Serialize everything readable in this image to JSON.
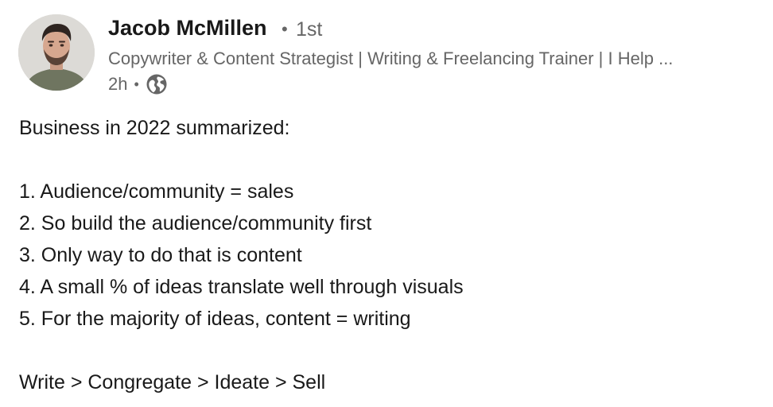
{
  "author": {
    "name": "Jacob McMillen",
    "degree": "1st",
    "headline": "Copywriter & Content Strategist | Writing & Freelancing Trainer | I Help ...",
    "time": "2h",
    "visibility_icon": "globe-icon",
    "separator": "•"
  },
  "post": {
    "line1": "Business in 2022 summarized:",
    "list": [
      "1. Audience/community = sales",
      "2. So build the audience/community first",
      "3. Only way to do that is content",
      "4. A small % of ideas translate well through visuals",
      "5. For the majority of ideas, content = writing"
    ],
    "closing": "Write > Congregate > Ideate > Sell"
  },
  "colors": {
    "text_primary": "#191919",
    "text_secondary": "#666666",
    "background": "#ffffff"
  }
}
